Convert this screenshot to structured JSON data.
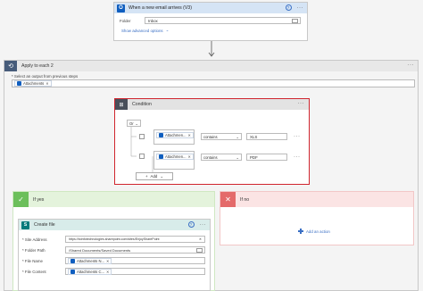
{
  "trigger": {
    "title": "When a new email arrives (V3)",
    "folder_label": "Folder",
    "folder_value": "Inbox",
    "show_advanced": "Show advanced options"
  },
  "apply_each": {
    "title": "Apply to each 2",
    "select_output_label": "* Select an output from previous steps",
    "token_label": "Attachments"
  },
  "condition": {
    "title": "Condition",
    "group_operator": "Or",
    "rows": [
      {
        "token": "Attachmen...",
        "operator": "contains",
        "value": "XLS"
      },
      {
        "token": "Attachmen...",
        "operator": "contains",
        "value": "PDF"
      }
    ],
    "add_label": "Add"
  },
  "yes_branch": {
    "title": "If yes"
  },
  "no_branch": {
    "title": "If no",
    "add_action": "Add an action"
  },
  "create_file": {
    "title": "Create file",
    "site_label": "* Site Address",
    "site_value": "https://toinfotechnologies.sharepoint.com/sites/EnjoySharePoint",
    "folder_label": "* Folder Path",
    "folder_value": "/Shared Documents/Saved Documents",
    "filename_label": "* File Name",
    "filename_token": "Attachments N...",
    "filecontent_label": "* File Content",
    "filecontent_token": "Attachments C..."
  },
  "colors": {
    "outlook_blue": "#0f5ebf",
    "condition_border": "#d0252e",
    "yes_green": "#6cbf5b",
    "no_red": "#e46a6a",
    "sharepoint_teal": "#047b7b"
  }
}
